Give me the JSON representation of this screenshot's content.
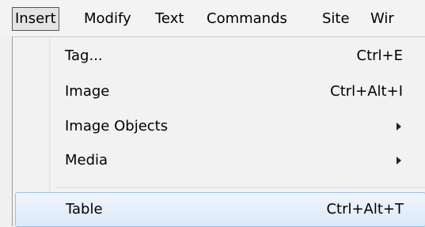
{
  "menubar": {
    "items": [
      {
        "label": "Insert"
      },
      {
        "label": "Modify"
      },
      {
        "label": "Text"
      },
      {
        "label": "Commands"
      },
      {
        "label": "Site"
      },
      {
        "label": "Wir"
      }
    ]
  },
  "insert_menu": {
    "items": [
      {
        "label": "Tag...",
        "shortcut": "Ctrl+E"
      },
      {
        "label": "Image",
        "shortcut": "Ctrl+Alt+I"
      },
      {
        "label": "Image Objects",
        "shortcut": "",
        "submenu_icon": "submenu-arrow-icon"
      },
      {
        "label": "Media",
        "shortcut": "",
        "submenu_icon": "submenu-arrow-icon"
      },
      {
        "label": "Table",
        "shortcut": "Ctrl+Alt+T",
        "highlighted": true
      }
    ]
  },
  "colors": {
    "highlight_border": "#9ebde3",
    "highlight_fill": "#dde9f8",
    "menu_background": "#f2f2f2"
  }
}
